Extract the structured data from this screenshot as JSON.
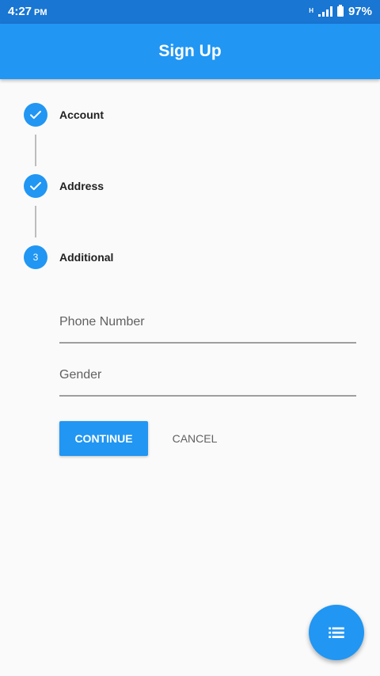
{
  "status_bar": {
    "time": "4:27",
    "ampm": "PM",
    "network_type": "H",
    "battery": "97%"
  },
  "app_bar": {
    "title": "Sign Up"
  },
  "stepper": {
    "steps": [
      {
        "label": "Account",
        "state": "complete",
        "icon": "check-icon"
      },
      {
        "label": "Address",
        "state": "complete",
        "icon": "check-icon"
      },
      {
        "label": "Additional",
        "state": "active",
        "number": "3"
      }
    ]
  },
  "form": {
    "phone_placeholder": "Phone Number",
    "gender_placeholder": "Gender"
  },
  "actions": {
    "continue_label": "CONTINUE",
    "cancel_label": "CANCEL"
  },
  "fab": {
    "icon": "list-icon"
  },
  "colors": {
    "primary": "#2196f3",
    "primary_dark": "#1976d2",
    "background": "#fafafa"
  }
}
